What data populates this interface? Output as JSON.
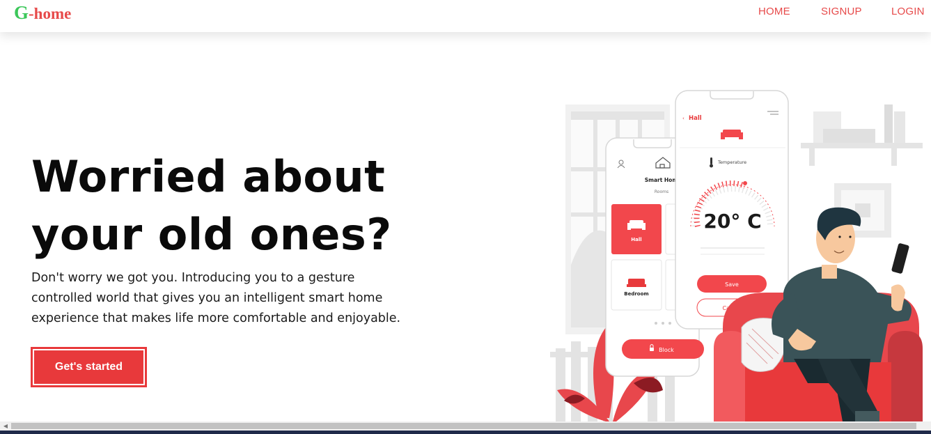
{
  "brand": {
    "first_letter": "G",
    "rest": "-home"
  },
  "nav": {
    "home": "HOME",
    "signup": "SIGNUP",
    "login": "LOGIN"
  },
  "hero": {
    "headline_line1": "Worried about",
    "headline_line2": "your old ones?",
    "subtext_line1": "Don't worry we got you. Introducing you to a gesture",
    "subtext_line2": "controlled world that gives you an intelligent smart home",
    "subtext_line3": "experience that makes life more comfortable and enjoyable.",
    "cta_label": "Get's started"
  },
  "phone_back": {
    "title": "Smart Home",
    "section": "Rooms",
    "rooms": [
      "Hall",
      "Bedroom"
    ],
    "lock_label": "Block"
  },
  "phone_front": {
    "back_label": "Hall",
    "sensor_label": "Temperature",
    "temperature": "20° C",
    "save_label": "Save",
    "cancel_label": "Cancel"
  },
  "colors": {
    "accent": "#e8393b",
    "brand_green": "#3cc75a",
    "brand_red": "#e74a4a",
    "text_dark": "#0a0a0a"
  }
}
